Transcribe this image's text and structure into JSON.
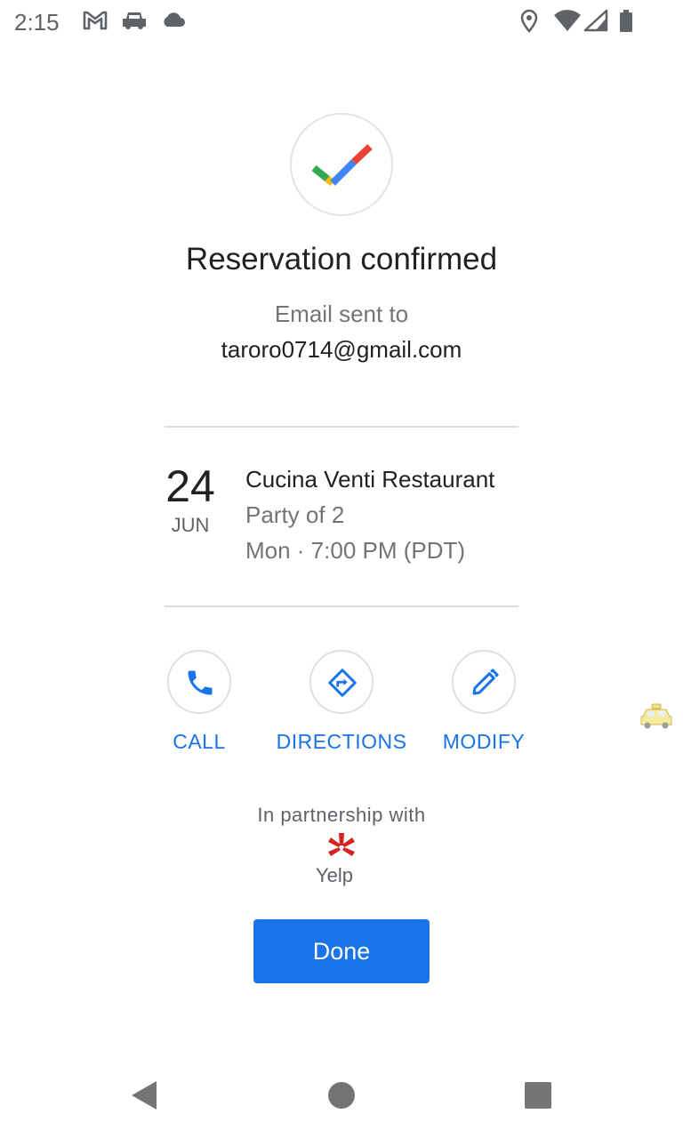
{
  "status_bar": {
    "time": "2:15",
    "left_icons": [
      "gmail-icon",
      "car-icon",
      "cloud-icon"
    ],
    "right_icons": [
      "location-icon",
      "wifi-icon",
      "signal-icon",
      "battery-icon"
    ]
  },
  "confirmation": {
    "title": "Reservation confirmed",
    "email_label": "Email sent to",
    "email": "taroro0714@gmail.com"
  },
  "reservation": {
    "day": "24",
    "month": "JUN",
    "restaurant": "Cucina Venti Restaurant",
    "party": "Party of 2",
    "time": "Mon · 7:00 PM (PDT)"
  },
  "actions": [
    {
      "label": "CALL",
      "icon": "phone-icon"
    },
    {
      "label": "DIRECTIONS",
      "icon": "directions-icon"
    },
    {
      "label": "MODIFY",
      "icon": "pencil-icon"
    }
  ],
  "partner": {
    "text": "In partnership with",
    "name": "Yelp"
  },
  "done_button": "Done",
  "colors": {
    "accent": "#1a73e8",
    "yelp_red": "#d32323",
    "google_green": "#34a853",
    "google_yellow": "#fbbc04",
    "google_blue": "#4285f4",
    "google_red": "#ea4335"
  }
}
